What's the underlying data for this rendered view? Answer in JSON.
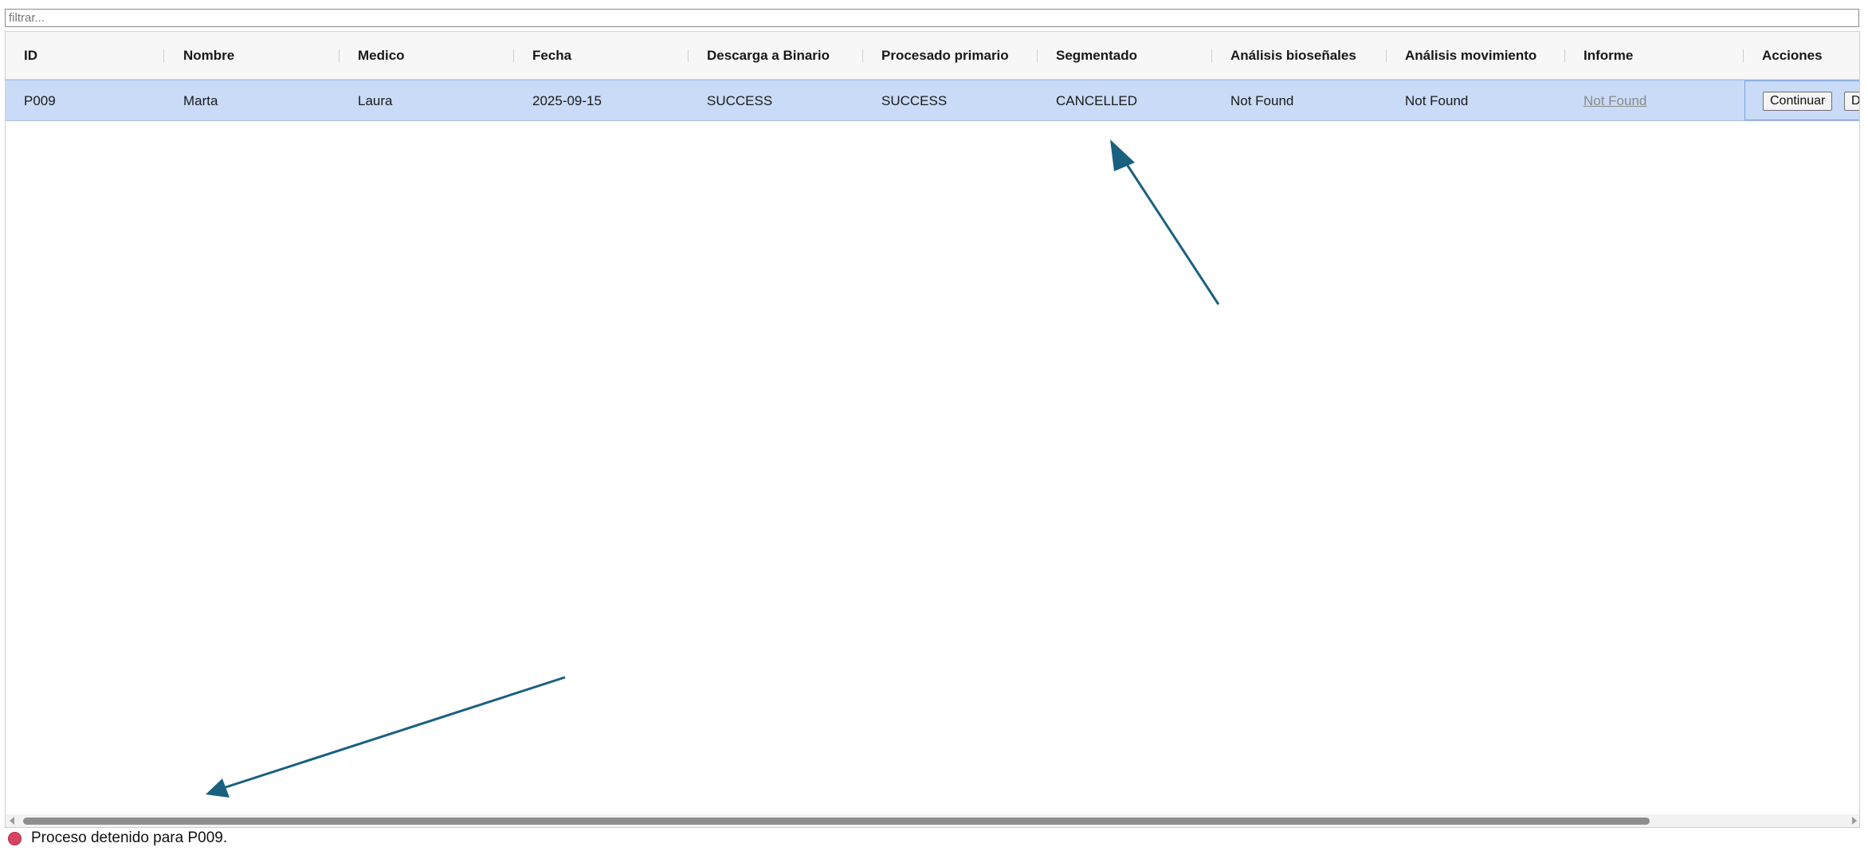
{
  "filter": {
    "placeholder": "filtrar..."
  },
  "table": {
    "columns": [
      "ID",
      "Nombre",
      "Medico",
      "Fecha",
      "Descarga a Binario",
      "Procesado primario",
      "Segmentado",
      "Análisis bioseñales",
      "Análisis movimiento",
      "Informe",
      "Acciones"
    ],
    "rows": [
      {
        "id": "P009",
        "nombre": "Marta",
        "medico": "Laura",
        "fecha": "2025-09-15",
        "descarga": "SUCCESS",
        "procesado": "SUCCESS",
        "segmentado": "CANCELLED",
        "bio": "Not Found",
        "movimiento": "Not Found",
        "informe": "Not Found",
        "actions": {
          "continue_label": "Continuar",
          "second_label": "D"
        }
      }
    ]
  },
  "status": {
    "text": "Proceso detenido para P009.",
    "color": "#d6455f"
  },
  "colors": {
    "selected_row": "#c9dbf6",
    "annotation_arrow": "#1a6080"
  }
}
